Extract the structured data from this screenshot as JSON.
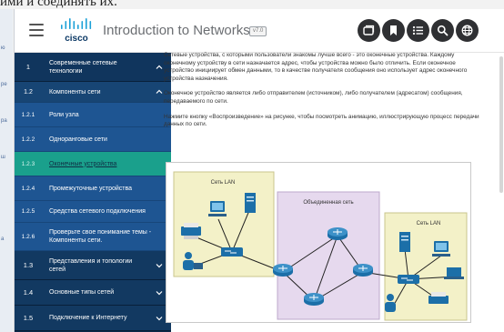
{
  "background_page": {
    "top_text": "ими и соединять их."
  },
  "header": {
    "logo_text": "cisco",
    "title": "Introduction to Networks",
    "version": "v7.0",
    "icons": [
      "cards-icon",
      "bookmark-icon",
      "list-icon",
      "search-icon",
      "globe-icon"
    ]
  },
  "sidebar": {
    "module1": {
      "num": "1",
      "label": "Современные сетевые технологии"
    },
    "section12": {
      "num": "1.2",
      "label": "Компоненты сети"
    },
    "items": [
      {
        "num": "1.2.1",
        "label": "Роли узла"
      },
      {
        "num": "1.2.2",
        "label": "Одноранговые сети"
      },
      {
        "num": "1.2.3",
        "label": "Оконечные устройства"
      },
      {
        "num": "1.2.4",
        "label": "Промежуточные устройства"
      },
      {
        "num": "1.2.5",
        "label": "Средства сетевого подключения"
      },
      {
        "num": "1.2.6",
        "label": "Проверьте свое понимание темы - Компоненты сети."
      }
    ],
    "section13": {
      "num": "1.3",
      "label": "Представления и топологии сетей"
    },
    "section14": {
      "num": "1.4",
      "label": "Основные типы сетей"
    },
    "section15": {
      "num": "1.5",
      "label": "Подключение к Интернету"
    }
  },
  "content": {
    "p1": "Сетевые устройства, с которыми пользователи знакомы лучше всего - это оконечные устройства. Каждому оконечному устройству в сети назначается адрес, чтобы устройства можно было отличить. Если оконечное устройство инициирует обмен данными, то в качестве получателя сообщения оно использует адрес оконечного устройства назначения.",
    "p2": "Оконечное устройство является либо отправителем (источником), либо получателем (адресатом) сообщения, передаваемого по сети.",
    "p3": "Нажмите кнопку «Воспроизведение» на рисунке, чтобы посмотреть анимацию, иллюстрирующую процесс передачи данных по сети."
  },
  "figure": {
    "lan_left": "Сеть LAN",
    "internetwork": "Объединенная сеть",
    "lan_right": "Сеть LAN"
  },
  "colors": {
    "sidebar_dark": "#0b2a4a",
    "sidebar_item": "#1e5592",
    "active_item": "#1aa08c",
    "lan_zone": "#f3f1c8",
    "internet_zone": "#e6d9ee",
    "device_blue": "#1c6fa8"
  }
}
